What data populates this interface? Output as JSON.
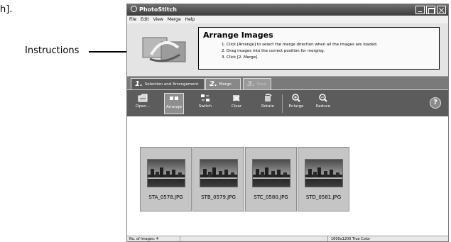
{
  "page": {
    "fragment": "h].",
    "annotation_label": "Instructions"
  },
  "window": {
    "title": "PhotoStitch"
  },
  "menu": [
    "File",
    "Edit",
    "View",
    "Merge",
    "Help"
  ],
  "instructions": {
    "title": "Arrange Images",
    "steps": [
      "1. Click [Arrange] to select the merge direction when all the images are loaded.",
      "2. Drag images into the correct position for merging.",
      "3. Click [2. Merge]."
    ]
  },
  "tabs": [
    {
      "num": "1.",
      "label": "Selection and Arrangement",
      "state": "active"
    },
    {
      "num": "2.",
      "label": "Merge",
      "state": "normal"
    },
    {
      "num": "3.",
      "label": "Save",
      "state": "disabled"
    }
  ],
  "toolbar": [
    {
      "label": "Open...",
      "icon": "open-folder-icon",
      "active": false
    },
    {
      "label": "Arrange",
      "icon": "arrange-icon",
      "active": true
    },
    {
      "label": "Switch",
      "icon": "switch-icon",
      "active": false
    },
    {
      "label": "Clear",
      "icon": "clear-icon",
      "active": false
    },
    {
      "label": "Rotate",
      "icon": "rotate-icon",
      "active": false
    },
    {
      "label": "Enlarge",
      "icon": "zoom-in-icon",
      "active": false
    },
    {
      "label": "Reduce",
      "icon": "zoom-out-icon",
      "active": false
    }
  ],
  "help_label": "?",
  "images": [
    {
      "name": "STA_0578.JPG"
    },
    {
      "name": "STB_0579.JPG"
    },
    {
      "name": "STC_0580.JPG"
    },
    {
      "name": "STD_0581.JPG"
    }
  ],
  "status": {
    "count": "No. of Images: 4",
    "resolution": "1600x1200 True Color"
  }
}
